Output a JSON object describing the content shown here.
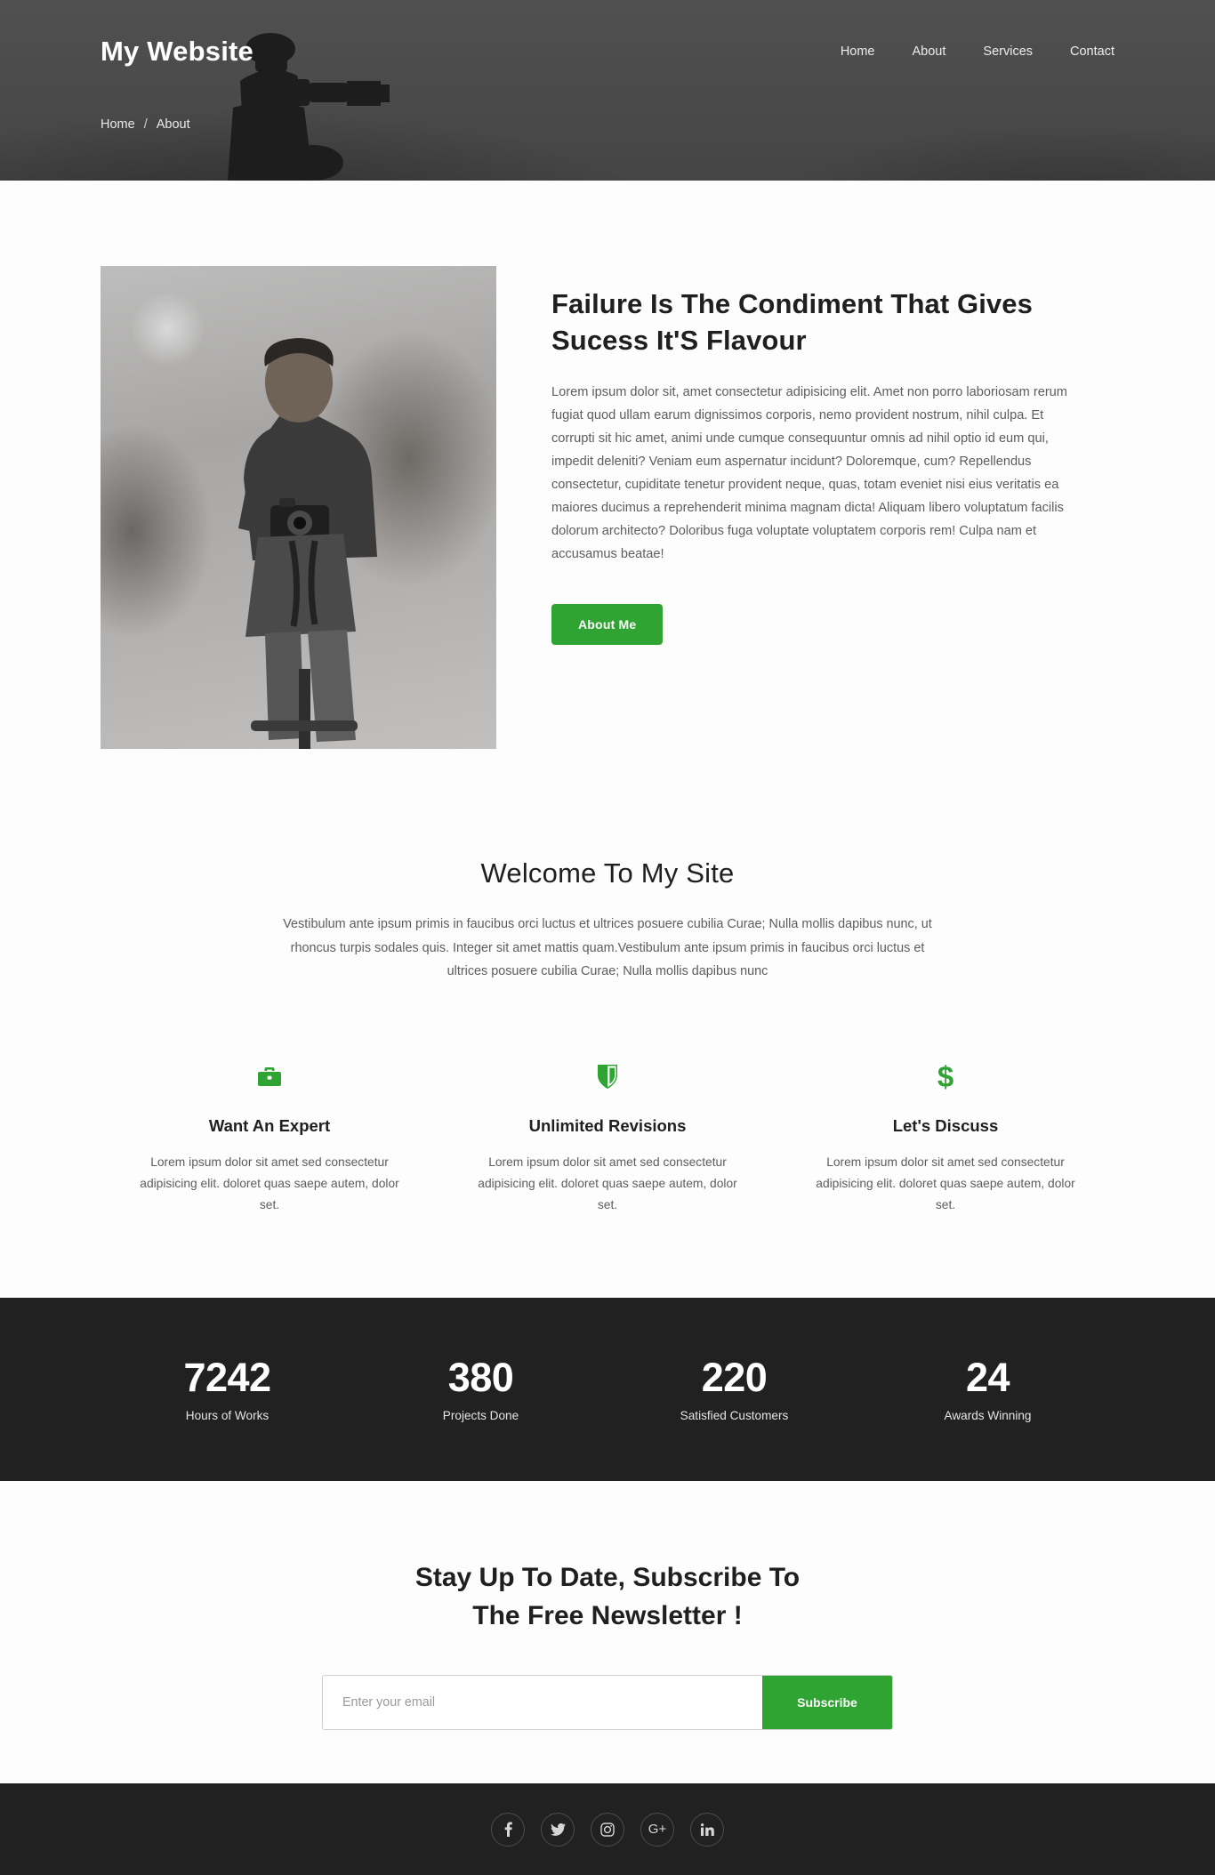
{
  "header": {
    "logo": "My Website",
    "nav": [
      {
        "label": "Home",
        "name": "nav-link-home"
      },
      {
        "label": "About",
        "name": "nav-link-about"
      },
      {
        "label": "Services",
        "name": "nav-link-services"
      },
      {
        "label": "Contact",
        "name": "nav-link-contact"
      }
    ],
    "breadcrumb": {
      "home": "Home",
      "separator": "/",
      "current": "About"
    }
  },
  "about": {
    "title": "Failure Is The Condiment That Gives Sucess It'S Flavour",
    "paragraph": "Lorem ipsum dolor sit, amet consectetur adipisicing elit. Amet non porro laboriosam rerum fugiat quod ullam earum dignissimos corporis, nemo provident nostrum, nihil culpa. Et corrupti sit hic amet, animi unde cumque consequuntur omnis ad nihil optio id eum qui, impedit deleniti? Veniam eum aspernatur incidunt? Doloremque, cum? Repellendus consectetur, cupiditate tenetur provident neque, quas, totam eveniet nisi eius veritatis ea maiores ducimus a reprehenderit minima magnam dicta! Aliquam libero voluptatum facilis dolorum architecto? Doloribus fuga voluptate voluptatem corporis rem! Culpa nam et accusamus beatae!",
    "button": "About Me",
    "photo_alt": "photographer-portrait"
  },
  "welcome": {
    "heading": "Welcome To My Site",
    "text": "Vestibulum ante ipsum primis in faucibus orci luctus et ultrices posuere cubilia Curae; Nulla mollis dapibus nunc, ut rhoncus turpis sodales quis. Integer sit amet mattis quam.Vestibulum ante ipsum primis in faucibus orci luctus et ultrices posuere cubilia Curae; Nulla mollis dapibus nunc"
  },
  "features": [
    {
      "icon": "briefcase-icon",
      "title": "Want An Expert",
      "text": "Lorem ipsum dolor sit amet sed consectetur adipisicing elit. doloret quas saepe autem, dolor set."
    },
    {
      "icon": "shield-icon",
      "title": "Unlimited Revisions",
      "text": "Lorem ipsum dolor sit amet sed consectetur adipisicing elit. doloret quas saepe autem, dolor set."
    },
    {
      "icon": "dollar-icon",
      "title": "Let's Discuss",
      "text": "Lorem ipsum dolor sit amet sed consectetur adipisicing elit. doloret quas saepe autem, dolor set."
    }
  ],
  "stats": [
    {
      "value": "7242",
      "label": "Hours of Works"
    },
    {
      "value": "380",
      "label": "Projects Done"
    },
    {
      "value": "220",
      "label": "Satisfied Customers"
    },
    {
      "value": "24",
      "label": "Awards Winning"
    }
  ],
  "newsletter": {
    "heading_line1": "Stay Up To Date, Subscribe To",
    "heading_line2": "The Free Newsletter !",
    "placeholder": "Enter your email",
    "value": "",
    "button": "Subscribe"
  },
  "footer": {
    "socials": [
      {
        "name": "facebook-icon",
        "label": "f"
      },
      {
        "name": "twitter-icon",
        "label": ""
      },
      {
        "name": "instagram-icon",
        "label": ""
      },
      {
        "name": "googleplus-icon",
        "label": "G+"
      },
      {
        "name": "linkedin-icon",
        "label": "in"
      }
    ]
  },
  "colors": {
    "accent_green": "#2fa432",
    "banner_gray": "#4a4a4a",
    "dark_band": "#212121",
    "page_bg": "#fdfdfd"
  }
}
